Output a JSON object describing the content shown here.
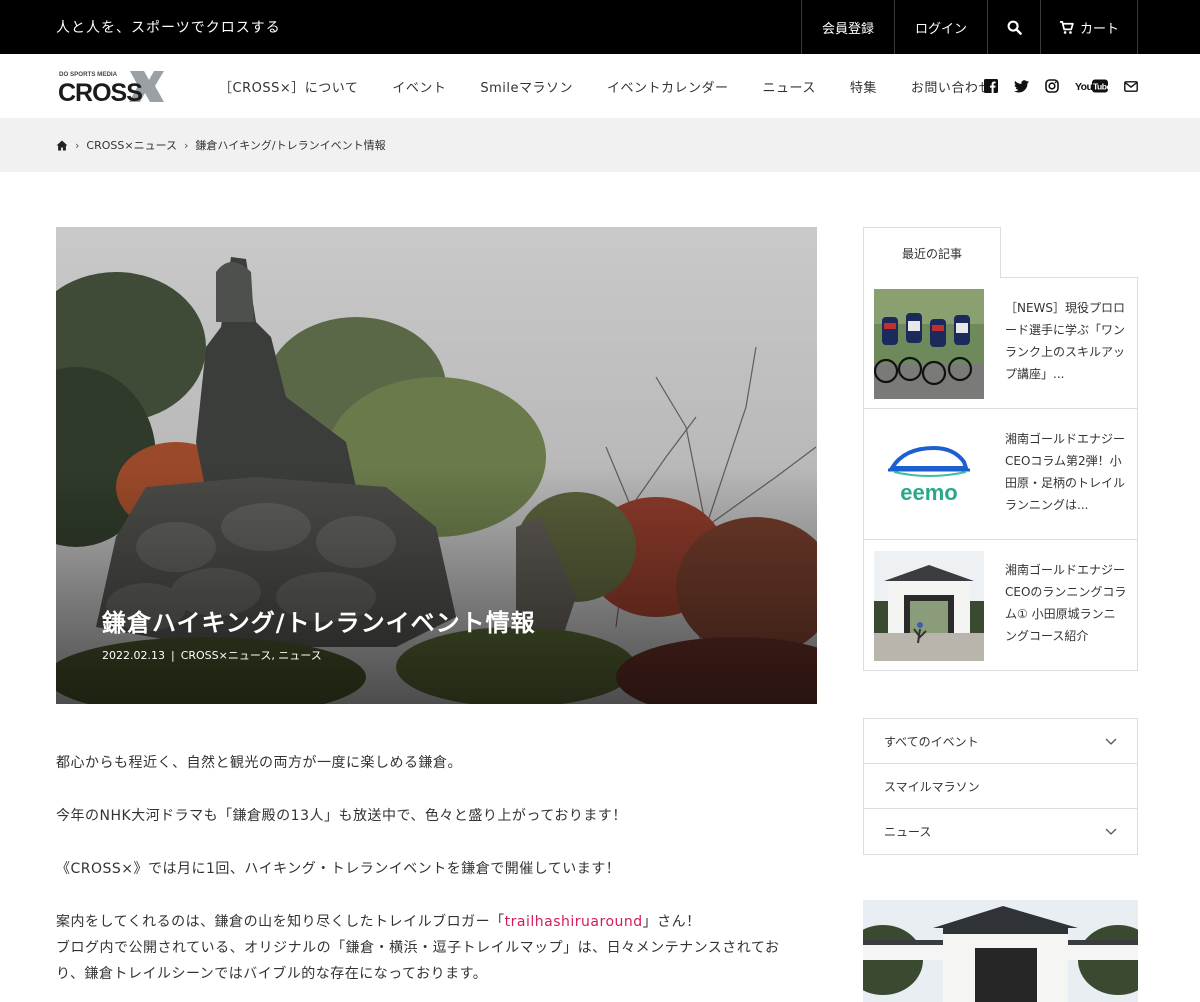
{
  "topbar": {
    "tagline": "人と人を、スポーツでクロスする",
    "register": "会員登録",
    "login": "ログイン",
    "cart": "カート"
  },
  "logo": {
    "small_text": "DO SPORTS MEDIA",
    "main_text": "CROSS"
  },
  "nav": {
    "items": [
      "［CROSS×］について",
      "イベント",
      "Smileマラソン",
      "イベントカレンダー",
      "ニュース",
      "特集",
      "お問い合わせ"
    ]
  },
  "social": {
    "youtube_text": "YouTube"
  },
  "breadcrumb": {
    "item1": "CROSS×ニュース",
    "item2": "鎌倉ハイキング/トレランイベント情報"
  },
  "hero": {
    "title": "鎌倉ハイキング/トレランイベント情報",
    "date": "2022.02.13",
    "categories": "CROSS×ニュース, ニュース"
  },
  "article": {
    "p1": "都心からも程近く、自然と観光の両方が一度に楽しめる鎌倉。",
    "p2": "今年のNHK大河ドラマも「鎌倉殿の13人」も放送中で、色々と盛り上がっております！",
    "p3": "《CROSS×》では月に1回、ハイキング・トレランイベントを鎌倉で開催しています！",
    "p4_pre": "案内をしてくれるのは、鎌倉の山を知り尽くしたトレイルブロガー「",
    "p4_link": "trailhashiruaround",
    "p4_post": "」さん！",
    "p5": "ブログ内で公開されている、オリジナルの「鎌倉・横浜・逗子トレイルマップ」は、日々メンテナンスされてお",
    "p6": "り、鎌倉トレイルシーンではバイブル的な存在になっております。"
  },
  "sidebar": {
    "recent_label": "最近の記事",
    "recent": [
      {
        "title": "［NEWS］現役プロロード選手に学ぶ「ワンランク上のスキルアップ講座」..."
      },
      {
        "title": "湘南ゴールドエナジーCEOコラム第2弾！小田原・足柄のトレイルランニングは...",
        "thumb_text": "eemo"
      },
      {
        "title": "湘南ゴールドエナジーCEOのランニングコラム① 小田原城ランニングコース紹介"
      }
    ],
    "categories": [
      {
        "label": "すべてのイベント",
        "expandable": true
      },
      {
        "label": "スマイルマラソン",
        "expandable": false
      },
      {
        "label": "ニュース",
        "expandable": true
      }
    ]
  }
}
